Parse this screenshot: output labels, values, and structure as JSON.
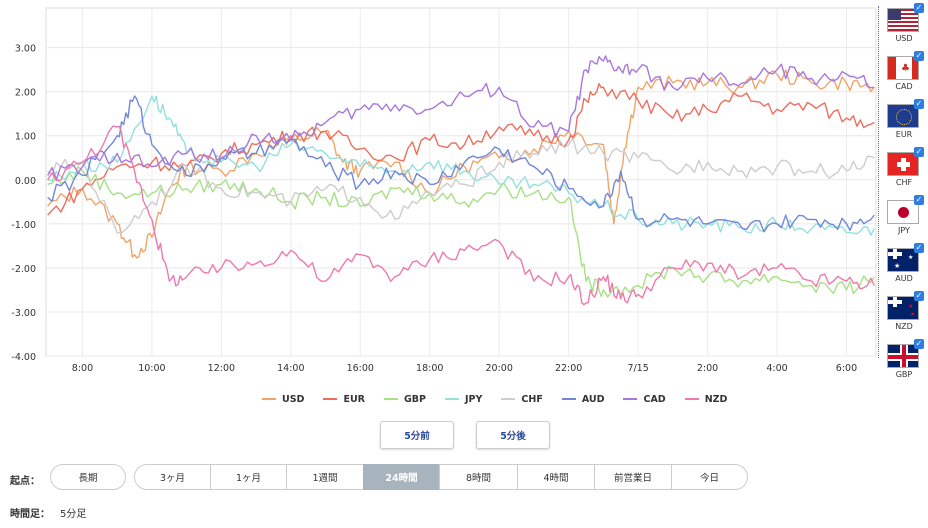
{
  "chart_data": {
    "type": "line",
    "y_ticks": [
      "3.00",
      "2.00",
      "1.00",
      "0.00",
      "-1.00",
      "-2.00",
      "-3.00",
      "-4.00"
    ],
    "ylim": [
      -4,
      3.9
    ],
    "x_ticks": [
      "8:00",
      "10:00",
      "12:00",
      "14:00",
      "16:00",
      "18:00",
      "20:00",
      "22:00",
      "7/15",
      "2:00",
      "4:00",
      "6:00"
    ],
    "x_range_hours": [
      -1.05,
      22.85
    ],
    "grid": true,
    "series": [
      {
        "name": "USD",
        "color": "#f0a469",
        "points": [
          [
            -1,
            -0.6
          ],
          [
            0,
            -0.2
          ],
          [
            1,
            -1.0
          ],
          [
            1.5,
            -1.7
          ],
          [
            2,
            -1.3
          ],
          [
            2.5,
            -0.2
          ],
          [
            3,
            0.3
          ],
          [
            4,
            0.2
          ],
          [
            5,
            0.6
          ],
          [
            6,
            0.9
          ],
          [
            7,
            1.1
          ],
          [
            7.5,
            0.4
          ],
          [
            8,
            0.2
          ],
          [
            9,
            0.4
          ],
          [
            10,
            -0.3
          ],
          [
            11,
            0.3
          ],
          [
            12,
            0.5
          ],
          [
            13,
            0.7
          ],
          [
            14,
            1.1
          ],
          [
            15,
            0.8
          ],
          [
            15.3,
            -1.0
          ],
          [
            15.6,
            0.7
          ],
          [
            16,
            2.1
          ],
          [
            17,
            2.2
          ],
          [
            18,
            2.2
          ],
          [
            19,
            2.1
          ],
          [
            20,
            2.4
          ],
          [
            21,
            2.2
          ],
          [
            22,
            2.2
          ],
          [
            22.8,
            2.1
          ]
        ]
      },
      {
        "name": "EUR",
        "color": "#ee6e5e",
        "points": [
          [
            -1,
            -0.8
          ],
          [
            0,
            -0.2
          ],
          [
            1,
            0.3
          ],
          [
            2,
            0.4
          ],
          [
            3,
            0.3
          ],
          [
            4,
            0.6
          ],
          [
            5,
            0.8
          ],
          [
            6,
            1.0
          ],
          [
            7,
            1.1
          ],
          [
            8,
            0.7
          ],
          [
            9,
            0.5
          ],
          [
            10,
            0.9
          ],
          [
            11,
            0.8
          ],
          [
            12,
            1.2
          ],
          [
            13,
            1.0
          ],
          [
            14,
            0.9
          ],
          [
            14.5,
            1.8
          ],
          [
            15,
            2.1
          ],
          [
            16,
            1.8
          ],
          [
            17,
            1.4
          ],
          [
            18,
            1.6
          ],
          [
            19,
            1.9
          ],
          [
            20,
            1.6
          ],
          [
            21,
            1.7
          ],
          [
            22,
            1.4
          ],
          [
            22.8,
            1.3
          ]
        ]
      },
      {
        "name": "GBP",
        "color": "#a6e184",
        "points": [
          [
            -1,
            -0.1
          ],
          [
            0,
            0.2
          ],
          [
            1,
            -0.3
          ],
          [
            2,
            -0.3
          ],
          [
            3,
            -0.2
          ],
          [
            4,
            -0.1
          ],
          [
            5,
            -0.2
          ],
          [
            6,
            -0.5
          ],
          [
            7,
            -0.4
          ],
          [
            8,
            -0.6
          ],
          [
            9,
            -0.2
          ],
          [
            10,
            -0.3
          ],
          [
            11,
            -0.5
          ],
          [
            12,
            -0.2
          ],
          [
            13,
            -0.3
          ],
          [
            14,
            -0.4
          ],
          [
            14.5,
            -2.3
          ],
          [
            15,
            -2.5
          ],
          [
            16,
            -2.4
          ],
          [
            17,
            -2.0
          ],
          [
            18,
            -2.2
          ],
          [
            19,
            -2.3
          ],
          [
            20,
            -2.2
          ],
          [
            21,
            -2.4
          ],
          [
            22,
            -2.5
          ],
          [
            22.8,
            -2.2
          ]
        ]
      },
      {
        "name": "JPY",
        "color": "#93e0dd",
        "points": [
          [
            -1,
            0.0
          ],
          [
            0,
            0.3
          ],
          [
            1,
            0.4
          ],
          [
            2,
            1.9
          ],
          [
            2.5,
            1.4
          ],
          [
            3,
            0.6
          ],
          [
            4,
            0.4
          ],
          [
            5,
            0.3
          ],
          [
            6,
            0.8
          ],
          [
            7,
            0.6
          ],
          [
            8,
            0.3
          ],
          [
            9,
            0.2
          ],
          [
            10,
            0.4
          ],
          [
            11,
            0.2
          ],
          [
            12,
            -0.1
          ],
          [
            13,
            -0.1
          ],
          [
            14,
            -0.3
          ],
          [
            15,
            -0.6
          ],
          [
            16,
            -0.9
          ],
          [
            17,
            -1.0
          ],
          [
            18,
            -1.0
          ],
          [
            19,
            -1.1
          ],
          [
            20,
            -1.0
          ],
          [
            21,
            -1.1
          ],
          [
            22,
            -1.2
          ],
          [
            22.8,
            -1.1
          ]
        ]
      },
      {
        "name": "CHF",
        "color": "#cdcdcd",
        "points": [
          [
            -1,
            0.2
          ],
          [
            0,
            0.4
          ],
          [
            1,
            -1.2
          ],
          [
            2,
            -0.5
          ],
          [
            3,
            0.3
          ],
          [
            4,
            -0.2
          ],
          [
            5,
            -0.3
          ],
          [
            6,
            -0.5
          ],
          [
            7,
            -0.2
          ],
          [
            8,
            -0.4
          ],
          [
            9,
            -0.9
          ],
          [
            10,
            -0.3
          ],
          [
            11,
            -0.1
          ],
          [
            12,
            0.4
          ],
          [
            13,
            0.6
          ],
          [
            14,
            0.8
          ],
          [
            15,
            0.6
          ],
          [
            16,
            0.5
          ],
          [
            17,
            0.2
          ],
          [
            18,
            0.4
          ],
          [
            19,
            0.2
          ],
          [
            20,
            0.3
          ],
          [
            21,
            0.2
          ],
          [
            22,
            0.2
          ],
          [
            22.8,
            0.5
          ]
        ]
      },
      {
        "name": "AUD",
        "color": "#7187d8",
        "points": [
          [
            -1,
            -0.4
          ],
          [
            0,
            0.1
          ],
          [
            1,
            1.0
          ],
          [
            1.5,
            1.9
          ],
          [
            2,
            0.8
          ],
          [
            3,
            0.1
          ],
          [
            4,
            0.5
          ],
          [
            5,
            0.6
          ],
          [
            6,
            0.9
          ],
          [
            7,
            0.3
          ],
          [
            8,
            -0.1
          ],
          [
            9,
            0.2
          ],
          [
            10,
            -0.1
          ],
          [
            11,
            0.4
          ],
          [
            12,
            0.7
          ],
          [
            13,
            0.3
          ],
          [
            14,
            -0.2
          ],
          [
            15,
            -0.6
          ],
          [
            15.5,
            0.2
          ],
          [
            16,
            -0.9
          ],
          [
            17,
            -0.9
          ],
          [
            18,
            -1.0
          ],
          [
            19,
            -1.1
          ],
          [
            20,
            -1.0
          ],
          [
            21,
            -0.9
          ],
          [
            22,
            -1.0
          ],
          [
            22.8,
            -0.8
          ]
        ]
      },
      {
        "name": "CAD",
        "color": "#a877dc",
        "points": [
          [
            -1,
            0.1
          ],
          [
            0,
            0.3
          ],
          [
            1,
            0.6
          ],
          [
            2,
            0.3
          ],
          [
            3,
            0.6
          ],
          [
            4,
            0.5
          ],
          [
            5,
            1.0
          ],
          [
            6,
            0.9
          ],
          [
            7,
            1.3
          ],
          [
            8,
            1.6
          ],
          [
            9,
            1.7
          ],
          [
            10,
            1.6
          ],
          [
            11,
            1.9
          ],
          [
            12,
            2.1
          ],
          [
            13,
            1.2
          ],
          [
            14,
            1.1
          ],
          [
            14.5,
            2.5
          ],
          [
            15,
            2.7
          ],
          [
            15.5,
            2.5
          ],
          [
            16,
            2.5
          ],
          [
            17,
            2.1
          ],
          [
            18,
            2.3
          ],
          [
            19,
            2.2
          ],
          [
            20,
            2.5
          ],
          [
            21,
            2.3
          ],
          [
            22,
            2.4
          ],
          [
            22.8,
            2.1
          ]
        ]
      },
      {
        "name": "NZD",
        "color": "#ee7aad",
        "points": [
          [
            -1,
            0.0
          ],
          [
            0,
            0.4
          ],
          [
            1,
            1.2
          ],
          [
            1.5,
            0.2
          ],
          [
            2,
            -0.9
          ],
          [
            2.5,
            -2.3
          ],
          [
            3,
            -2.2
          ],
          [
            4,
            -2.0
          ],
          [
            5,
            -1.9
          ],
          [
            6,
            -1.6
          ],
          [
            7,
            -2.3
          ],
          [
            8,
            -1.7
          ],
          [
            9,
            -2.2
          ],
          [
            10,
            -1.8
          ],
          [
            11,
            -1.6
          ],
          [
            12,
            -1.4
          ],
          [
            13,
            -2.3
          ],
          [
            14,
            -2.2
          ],
          [
            14.5,
            -2.8
          ],
          [
            15,
            -2.2
          ],
          [
            15.5,
            -2.7
          ],
          [
            16,
            -2.6
          ],
          [
            17,
            -2.0
          ],
          [
            18,
            -1.9
          ],
          [
            19,
            -2.2
          ],
          [
            20,
            -2.0
          ],
          [
            21,
            -2.3
          ],
          [
            22,
            -2.3
          ],
          [
            22.8,
            -2.4
          ]
        ]
      }
    ]
  },
  "legend": [
    {
      "label": "USD",
      "color": "#f0a469"
    },
    {
      "label": "EUR",
      "color": "#ee6e5e"
    },
    {
      "label": "GBP",
      "color": "#a6e184"
    },
    {
      "label": "JPY",
      "color": "#93e0dd"
    },
    {
      "label": "CHF",
      "color": "#cdcdcd"
    },
    {
      "label": "AUD",
      "color": "#7187d8"
    },
    {
      "label": "CAD",
      "color": "#a877dc"
    },
    {
      "label": "NZD",
      "color": "#ee7aad"
    }
  ],
  "currencies": [
    "USD",
    "CAD",
    "EUR",
    "CHF",
    "JPY",
    "AUD",
    "NZD",
    "GBP"
  ],
  "shift": {
    "prev": "5分前",
    "next": "5分後"
  },
  "start_label": "起点：",
  "periods": [
    "長期",
    "3ヶ月",
    "1ヶ月",
    "1週間",
    "24時間",
    "8時間",
    "4時間",
    "前営業日",
    "今日"
  ],
  "active_period": "24時間",
  "footer": {
    "label": "時間足：",
    "value": "5分足"
  }
}
